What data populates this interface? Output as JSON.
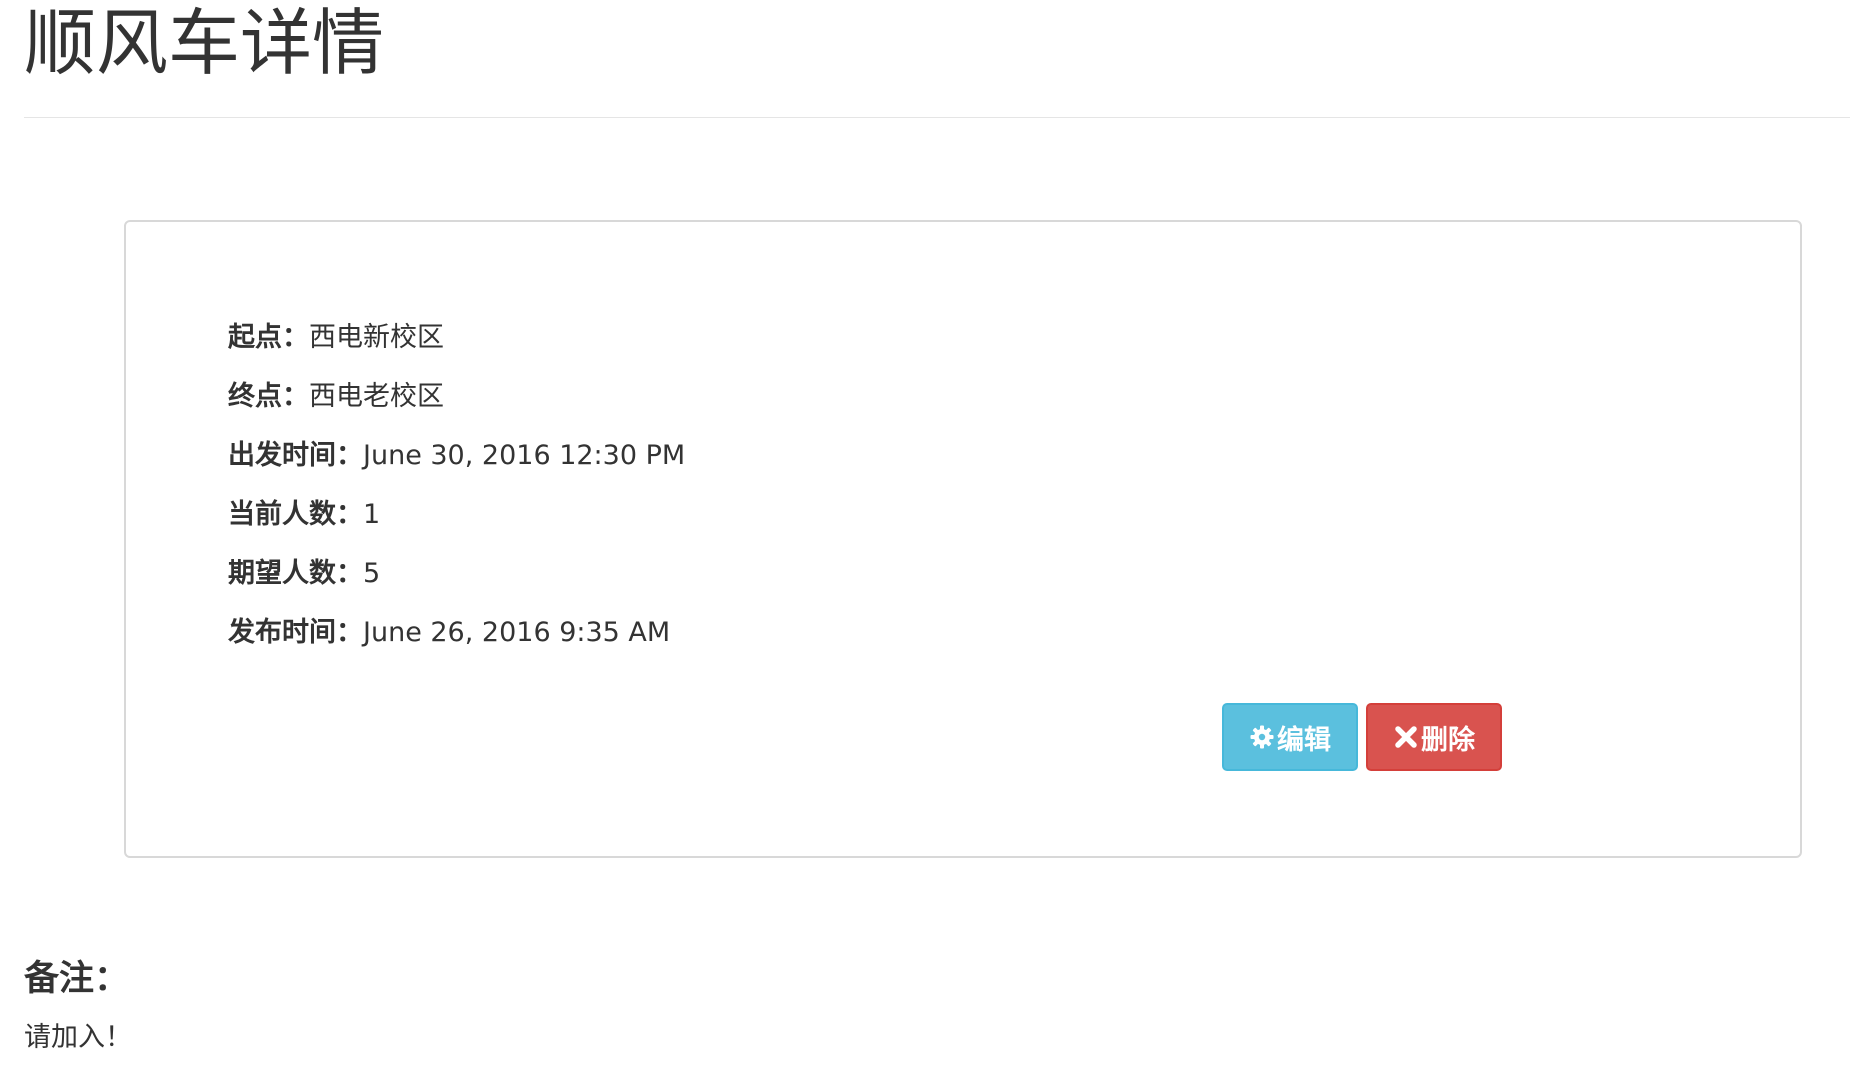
{
  "page": {
    "title": "顺风车详情"
  },
  "details": {
    "start": {
      "label": "起点：",
      "value": "西电新校区"
    },
    "end": {
      "label": "终点：",
      "value": "西电老校区"
    },
    "departure_time": {
      "label": "出发时间：",
      "value": "June 30, 2016 12:30 PM"
    },
    "current_count": {
      "label": "当前人数：",
      "value": "1"
    },
    "expected_count": {
      "label": "期望人数：",
      "value": "5"
    },
    "published_time": {
      "label": "发布时间：",
      "value": "June 26, 2016 9:35 AM"
    }
  },
  "actions": {
    "edit": {
      "label": "编辑",
      "icon": "gear-icon",
      "color": "#5bc0de"
    },
    "delete": {
      "label": "删除",
      "icon": "close-icon",
      "color": "#d9534f"
    }
  },
  "notes": {
    "heading": "备注：",
    "text": "请加入！"
  }
}
